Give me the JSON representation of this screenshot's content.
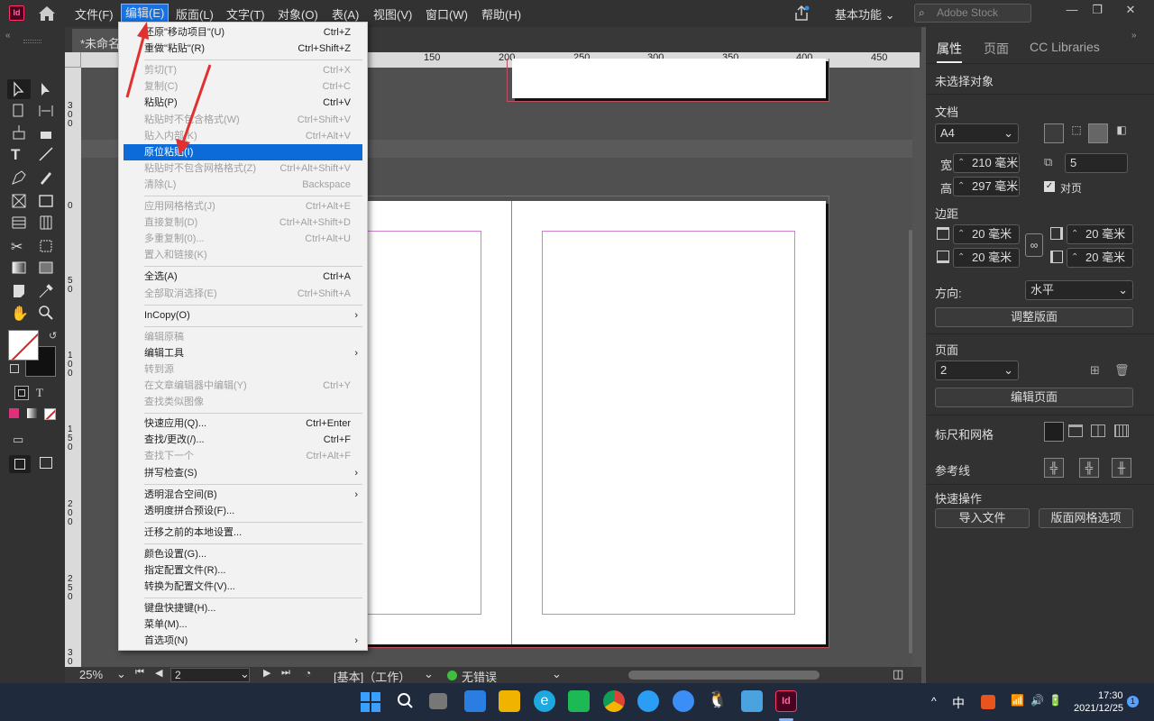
{
  "app": {
    "icon_label": "Id"
  },
  "menubar": {
    "items": [
      "文件(F)",
      "编辑(E)",
      "版面(L)",
      "文字(T)",
      "对象(O)",
      "表(A)",
      "视图(V)",
      "窗口(W)",
      "帮助(H)"
    ],
    "workspace": "基本功能",
    "search_placeholder": "Adobe Stock",
    "win_min": "—",
    "win_restore": "❐",
    "win_close": "✕"
  },
  "document": {
    "tab_title": "*未命名"
  },
  "ruler": {
    "h_ticks": [
      "150",
      "200",
      "250",
      "300",
      "350",
      "400",
      "450"
    ],
    "v_ticks": [
      "300",
      "0",
      "50",
      "100",
      "150",
      "200",
      "250",
      "300"
    ]
  },
  "edit_menu": {
    "rows": [
      {
        "label": "还原\"移动项目\"(U)",
        "shortcut": "Ctrl+Z",
        "disabled": false
      },
      {
        "label": "重做\"粘贴\"(R)",
        "shortcut": "Ctrl+Shift+Z",
        "disabled": false
      },
      {
        "sep": true
      },
      {
        "label": "剪切(T)",
        "shortcut": "Ctrl+X",
        "disabled": true
      },
      {
        "label": "复制(C)",
        "shortcut": "Ctrl+C",
        "disabled": true
      },
      {
        "label": "粘贴(P)",
        "shortcut": "Ctrl+V",
        "disabled": false
      },
      {
        "label": "粘贴时不包含格式(W)",
        "shortcut": "Ctrl+Shift+V",
        "disabled": true
      },
      {
        "label": "贴入内部(K)",
        "shortcut": "Ctrl+Alt+V",
        "disabled": true
      },
      {
        "label": "原位粘贴(I)",
        "shortcut": "",
        "disabled": false,
        "highlight": true
      },
      {
        "label": "粘贴时不包含网格格式(Z)",
        "shortcut": "Ctrl+Alt+Shift+V",
        "disabled": true
      },
      {
        "label": "清除(L)",
        "shortcut": "Backspace",
        "disabled": true
      },
      {
        "sep": true
      },
      {
        "label": "应用网格格式(J)",
        "shortcut": "Ctrl+Alt+E",
        "disabled": true
      },
      {
        "label": "直接复制(D)",
        "shortcut": "Ctrl+Alt+Shift+D",
        "disabled": true
      },
      {
        "label": "多重复制(0)...",
        "shortcut": "Ctrl+Alt+U",
        "disabled": true
      },
      {
        "label": "置入和链接(K)",
        "shortcut": "",
        "disabled": true
      },
      {
        "sep": true
      },
      {
        "label": "全选(A)",
        "shortcut": "Ctrl+A",
        "disabled": false
      },
      {
        "label": "全部取消选择(E)",
        "shortcut": "Ctrl+Shift+A",
        "disabled": true
      },
      {
        "sep": true
      },
      {
        "label": "InCopy(O)",
        "shortcut": "",
        "disabled": false,
        "submenu": true
      },
      {
        "sep": true
      },
      {
        "label": "编辑原稿",
        "shortcut": "",
        "disabled": true
      },
      {
        "label": "编辑工具",
        "shortcut": "",
        "disabled": false,
        "submenu": true
      },
      {
        "label": "转到源",
        "shortcut": "",
        "disabled": true
      },
      {
        "label": "在文章编辑器中编辑(Y)",
        "shortcut": "Ctrl+Y",
        "disabled": true
      },
      {
        "label": "查找类似图像",
        "shortcut": "",
        "disabled": true
      },
      {
        "sep": true
      },
      {
        "label": "快速应用(Q)...",
        "shortcut": "Ctrl+Enter",
        "disabled": false
      },
      {
        "label": "查找/更改(/)...",
        "shortcut": "Ctrl+F",
        "disabled": false
      },
      {
        "label": "查找下一个",
        "shortcut": "Ctrl+Alt+F",
        "disabled": true
      },
      {
        "label": "拼写检查(S)",
        "shortcut": "",
        "disabled": false,
        "submenu": true
      },
      {
        "sep": true
      },
      {
        "label": "透明混合空间(B)",
        "shortcut": "",
        "disabled": false,
        "submenu": true
      },
      {
        "label": "透明度拼合预设(F)...",
        "shortcut": "",
        "disabled": false
      },
      {
        "sep": true
      },
      {
        "label": "迁移之前的本地设置...",
        "shortcut": "",
        "disabled": false
      },
      {
        "sep": true
      },
      {
        "label": "颜色设置(G)...",
        "shortcut": "",
        "disabled": false
      },
      {
        "label": "指定配置文件(R)...",
        "shortcut": "",
        "disabled": false
      },
      {
        "label": "转换为配置文件(V)...",
        "shortcut": "",
        "disabled": false
      },
      {
        "sep": true
      },
      {
        "label": "键盘快捷键(H)...",
        "shortcut": "",
        "disabled": false
      },
      {
        "label": "菜单(M)...",
        "shortcut": "",
        "disabled": false
      },
      {
        "label": "首选项(N)",
        "shortcut": "",
        "disabled": false,
        "submenu": true
      }
    ]
  },
  "properties_panel": {
    "tabs": [
      "属性",
      "页面",
      "CC Libraries"
    ],
    "no_selection": "未选择对象",
    "doc_section": "文档",
    "preset": "A4",
    "width_label": "宽",
    "width": "210 毫米",
    "height_label": "高",
    "height": "297 毫米",
    "pages": "5",
    "facing_pages": "对页",
    "margins_section": "边距",
    "margin_top": "20 毫米",
    "margin_bottom": "20 毫米",
    "margin_inside": "20 毫米",
    "margin_outside": "20 毫米",
    "orientation_label": "方向:",
    "orientation": "水平",
    "adjust_layout": "调整版面",
    "page_section": "页面",
    "page_value": "2",
    "edit_page": "编辑页面",
    "rulers_grids": "标尺和网格",
    "guides": "参考线",
    "quick_actions": "快速操作",
    "import_file": "导入文件",
    "grid_options": "版面网格选项"
  },
  "statusbar": {
    "zoom": "25%",
    "page": "2",
    "master": "[基本]（工作）",
    "preflight": "无错误"
  },
  "taskbar": {
    "ime": "中",
    "time": "17:30",
    "date": "2021/12/25",
    "notif": "1"
  },
  "colors": {
    "accent": "#1473e6",
    "annotation_arrow": "#e03030",
    "menu_highlight": "#0c6bd8"
  }
}
